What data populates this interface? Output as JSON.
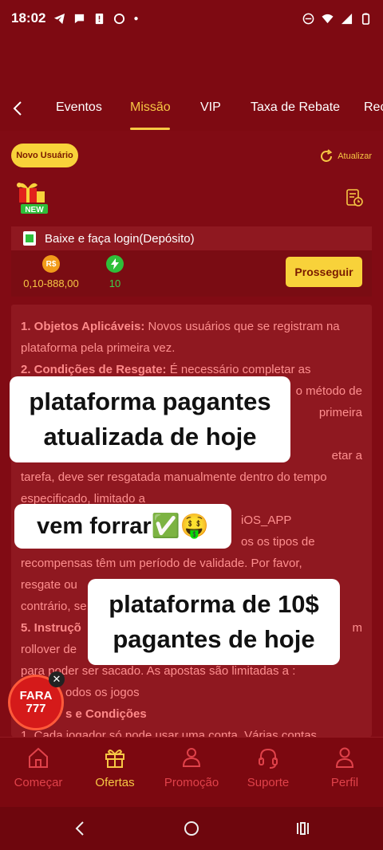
{
  "status_bar": {
    "time": "18:02"
  },
  "tabs": [
    {
      "label": "Eventos",
      "active": false
    },
    {
      "label": "Missão",
      "active": true
    },
    {
      "label": "VIP",
      "active": false
    },
    {
      "label": "Taxa de Rebate",
      "active": false
    },
    {
      "label": "Rec",
      "active": false
    }
  ],
  "badge": "Novo Usuário",
  "refresh_label": "Atualizar",
  "gift_badge": "NEW",
  "task": {
    "title": "Baixe e faça login(Depósito)",
    "cash_icon": "R$",
    "cash_value": "0,10-888,00",
    "exp_value": "10",
    "button": "Prosseguir"
  },
  "rules": {
    "r1_title": "1. Objetos Aplicáveis:",
    "r1_text": " Novos usuários que se registram na plataforma pela primeira vez.",
    "r2_title": "2. Condições de Resgate:",
    "r2_text": " É necessário completar as",
    "r2_frag1": "o método de",
    "r2_frag2": "primeira",
    "r3_frag": "etar a",
    "r3_line": "tarefa, deve ser resgatada manualmente dentro do tempo",
    "r3_line2": "especificado, limitado a",
    "r4_frag": "iOS_APP",
    "r4_frag2": "os os tipos de",
    "r4_line": "recompensas têm um período de validade. Por favor,",
    "r4_line2": "resgate ou",
    "r4_line3": "contrário, se",
    "r5_title": "5. Instruçõ",
    "r5_frag": "m",
    "r5_line": "rollover de",
    "r5_line2": "para poder ser sacado. As apostas são limitadas a :",
    "r5_line3": "odos os jogos",
    "r6_title": "s e Condições",
    "r6_line": "1. Cada jogador só pode usar uma conta. Várias contas"
  },
  "overlays": {
    "o1_line1": "plataforma pagantes",
    "o1_line2": "atualizada de hoje",
    "o2": "vem forrar✅🤑",
    "o3_line1": "plataforma de 10$",
    "o3_line2": "pagantes de hoje"
  },
  "promo": {
    "line1": "FARA",
    "line2": "777"
  },
  "bottom_nav": [
    {
      "label": "Começar",
      "icon": "home-icon",
      "active": false
    },
    {
      "label": "Ofertas",
      "icon": "gift-icon",
      "active": true
    },
    {
      "label": "Promoção",
      "icon": "people-icon",
      "active": false
    },
    {
      "label": "Suporte",
      "icon": "headset-icon",
      "active": false
    },
    {
      "label": "Perfil",
      "icon": "person-icon",
      "active": false
    }
  ],
  "colors": {
    "bg": "#7e0a12",
    "accent": "#f7c744",
    "nav_inactive": "#e0424a"
  }
}
